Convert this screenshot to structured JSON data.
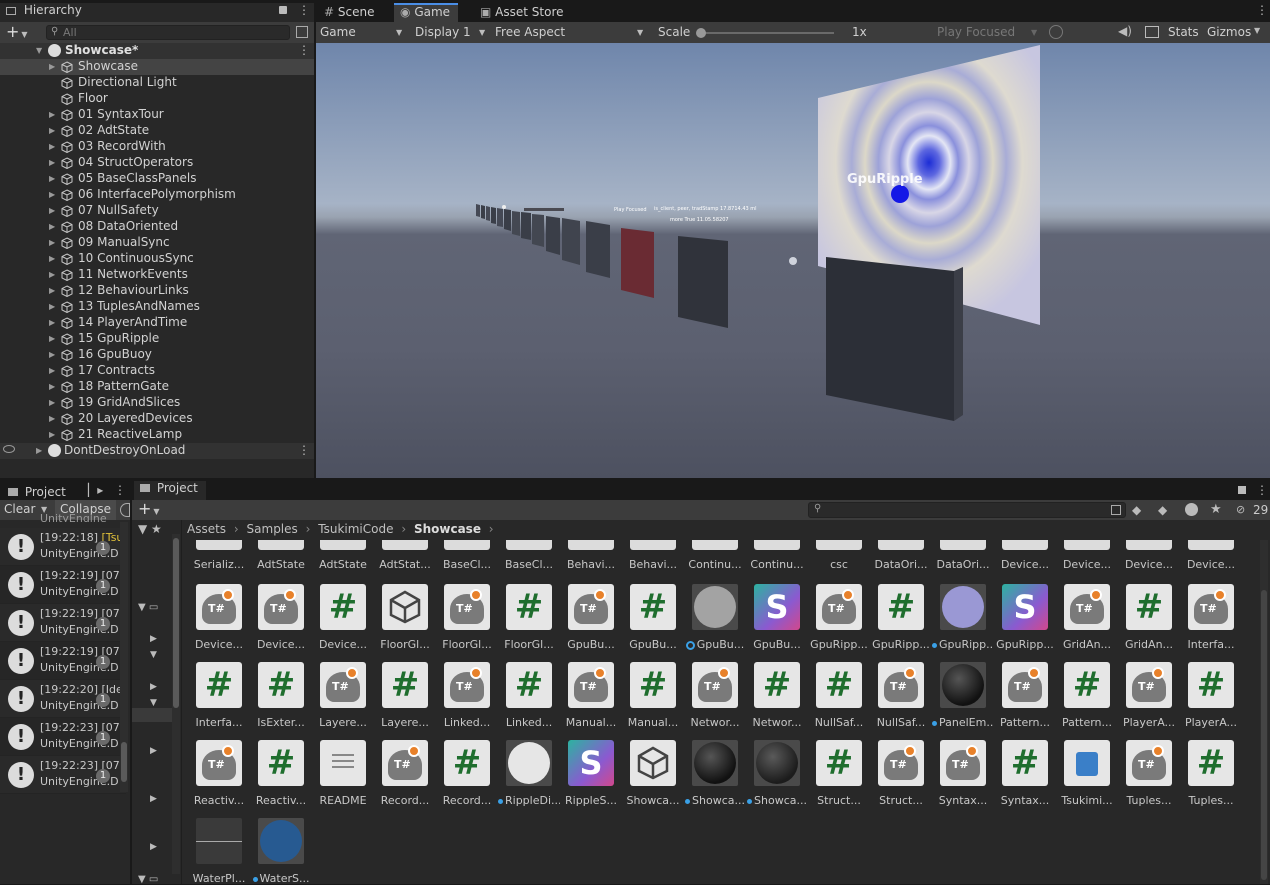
{
  "hierarchy": {
    "tab_label": "Hierarchy",
    "search_placeholder": "All",
    "scene_root": "Showcase*",
    "items": [
      {
        "label": "Showcase",
        "arrow": true
      },
      {
        "label": "Directional Light",
        "arrow": false
      },
      {
        "label": "Floor",
        "arrow": false
      },
      {
        "label": "01 SyntaxTour",
        "arrow": true
      },
      {
        "label": "02 AdtState",
        "arrow": true
      },
      {
        "label": "03 RecordWith",
        "arrow": true
      },
      {
        "label": "04 StructOperators",
        "arrow": true
      },
      {
        "label": "05 BaseClassPanels",
        "arrow": true
      },
      {
        "label": "06 InterfacePolymorphism",
        "arrow": true
      },
      {
        "label": "07 NullSafety",
        "arrow": true
      },
      {
        "label": "08 DataOriented",
        "arrow": true
      },
      {
        "label": "09 ManualSync",
        "arrow": true
      },
      {
        "label": "10 ContinuousSync",
        "arrow": true
      },
      {
        "label": "11 NetworkEvents",
        "arrow": true
      },
      {
        "label": "12 BehaviourLinks",
        "arrow": true
      },
      {
        "label": "13 TuplesAndNames",
        "arrow": true
      },
      {
        "label": "14 PlayerAndTime",
        "arrow": true
      },
      {
        "label": "15 GpuRipple",
        "arrow": true
      },
      {
        "label": "16 GpuBuoy",
        "arrow": true
      },
      {
        "label": "17 Contracts",
        "arrow": true
      },
      {
        "label": "18 PatternGate",
        "arrow": true
      },
      {
        "label": "19 GridAndSlices",
        "arrow": true
      },
      {
        "label": "20 LayeredDevices",
        "arrow": true
      },
      {
        "label": "21 ReactiveLamp",
        "arrow": true
      }
    ],
    "dont_destroy": "DontDestroyOnLoad"
  },
  "game": {
    "tabs": [
      "Scene",
      "Game",
      "Asset Store"
    ],
    "display_mode": "Game",
    "display": "Display 1",
    "aspect": "Free Aspect",
    "scale_label": "Scale",
    "scale_value": "1x",
    "play_mode": "Play Focused",
    "stats": "Stats",
    "gizmos": "Gizmos",
    "scene_label_ripple": "GpuRipple",
    "scene_tiny_1": "is_client, peer, tradStamp 17.8714.43 ml",
    "scene_tiny_2": "Play Focused",
    "scene_tiny_3": "more True 11.05.58207"
  },
  "console": {
    "tab_project": "Project",
    "clear": "Clear",
    "collapse": "Collapse",
    "top_partial": "UnityEngine",
    "logs": [
      {
        "time": "[19:22:18]",
        "msg": "[Tsu",
        "detail": "UnityEngine.D",
        "count": "1",
        "warn": true
      },
      {
        "time": "[19:22:19]",
        "msg": "[07",
        "detail": "UnityEngine.D",
        "count": "1",
        "warn": false
      },
      {
        "time": "[19:22:19]",
        "msg": "[07",
        "detail": "UnityEngine.D",
        "count": "1",
        "warn": false
      },
      {
        "time": "[19:22:19]",
        "msg": "[07",
        "detail": "UnityEngine.D",
        "count": "1",
        "warn": false
      },
      {
        "time": "[19:22:20]",
        "msg": "[Ide",
        "detail": "UnityEngine.D",
        "count": "1",
        "warn": false
      },
      {
        "time": "[19:22:23]",
        "msg": "[07",
        "detail": "UnityEngine.D",
        "count": "1",
        "warn": false
      },
      {
        "time": "[19:22:23]",
        "msg": "[07",
        "detail": "UnityEngine.D",
        "count": "1",
        "warn": false
      }
    ]
  },
  "project": {
    "tab_label": "Project",
    "breadcrumb": [
      "Assets",
      "Samples",
      "TsukimiCode",
      "Showcase"
    ],
    "hidden_count": "29",
    "top_row": [
      "Serializ...",
      "AdtState",
      "AdtState",
      "AdtStat...",
      "BaseCl...",
      "BaseCl...",
      "Behavi...",
      "Behavi...",
      "Continu...",
      "Continu...",
      "csc",
      "DataOri...",
      "DataOri...",
      "Device...",
      "Device...",
      "Device...",
      "Device..."
    ],
    "rows": [
      [
        {
          "name": "Device...",
          "kind": "ts"
        },
        {
          "name": "Device...",
          "kind": "ts"
        },
        {
          "name": "Device...",
          "kind": "cs"
        },
        {
          "name": "FloorGl...",
          "kind": "unity"
        },
        {
          "name": "FloorGl...",
          "kind": "ts"
        },
        {
          "name": "FloorGl...",
          "kind": "cs"
        },
        {
          "name": "GpuBu...",
          "kind": "ts"
        },
        {
          "name": "GpuBu...",
          "kind": "cs"
        },
        {
          "name": "GpuBu...",
          "kind": "mat-gray",
          "sel": true
        },
        {
          "name": "GpuBu...",
          "kind": "shader"
        },
        {
          "name": "GpuRipp...",
          "kind": "ts"
        },
        {
          "name": "GpuRipp...",
          "kind": "cs"
        },
        {
          "name": "GpuRipp...",
          "kind": "mat-lavender",
          "mark": true
        },
        {
          "name": "GpuRipp...",
          "kind": "shader"
        },
        {
          "name": "GridAn...",
          "kind": "ts"
        },
        {
          "name": "GridAn...",
          "kind": "cs"
        },
        {
          "name": "Interfa...",
          "kind": "ts"
        }
      ],
      [
        {
          "name": "Interfa...",
          "kind": "cs"
        },
        {
          "name": "IsExter...",
          "kind": "cs"
        },
        {
          "name": "Layere...",
          "kind": "ts"
        },
        {
          "name": "Layere...",
          "kind": "cs"
        },
        {
          "name": "Linked...",
          "kind": "ts"
        },
        {
          "name": "Linked...",
          "kind": "cs"
        },
        {
          "name": "Manual...",
          "kind": "ts"
        },
        {
          "name": "Manual...",
          "kind": "cs"
        },
        {
          "name": "Networ...",
          "kind": "ts"
        },
        {
          "name": "Networ...",
          "kind": "cs"
        },
        {
          "name": "NullSaf...",
          "kind": "cs"
        },
        {
          "name": "NullSaf...",
          "kind": "ts"
        },
        {
          "name": "PanelEm...",
          "kind": "mat-black",
          "mark": true
        },
        {
          "name": "Pattern...",
          "kind": "ts"
        },
        {
          "name": "Pattern...",
          "kind": "cs"
        },
        {
          "name": "PlayerA...",
          "kind": "ts"
        },
        {
          "name": "PlayerA...",
          "kind": "cs"
        }
      ],
      [
        {
          "name": "Reactiv...",
          "kind": "ts"
        },
        {
          "name": "Reactiv...",
          "kind": "cs"
        },
        {
          "name": "README",
          "kind": "doc"
        },
        {
          "name": "Record...",
          "kind": "ts"
        },
        {
          "name": "Record...",
          "kind": "cs"
        },
        {
          "name": "RippleDi...",
          "kind": "mat-white",
          "mark": true
        },
        {
          "name": "RippleS...",
          "kind": "shader"
        },
        {
          "name": "Showca...",
          "kind": "unity"
        },
        {
          "name": "Showca...",
          "kind": "mat-black",
          "mark": true
        },
        {
          "name": "Showca...",
          "kind": "mat-dark",
          "mark": true
        },
        {
          "name": "Struct...",
          "kind": "cs"
        },
        {
          "name": "Struct...",
          "kind": "ts"
        },
        {
          "name": "Syntax...",
          "kind": "ts"
        },
        {
          "name": "Syntax...",
          "kind": "cs"
        },
        {
          "name": "Tsukimi...",
          "kind": "puzzle"
        },
        {
          "name": "Tuples...",
          "kind": "ts"
        },
        {
          "name": "Tuples...",
          "kind": "cs"
        }
      ],
      [
        {
          "name": "WaterPl...",
          "kind": "plane"
        },
        {
          "name": "WaterS...",
          "kind": "mat-blue",
          "mark": true
        }
      ]
    ]
  },
  "colors": {
    "accent": "#4a8ee6",
    "selection": "#2c5d87",
    "panel": "#282828",
    "toolbar": "#3c3c3c"
  }
}
